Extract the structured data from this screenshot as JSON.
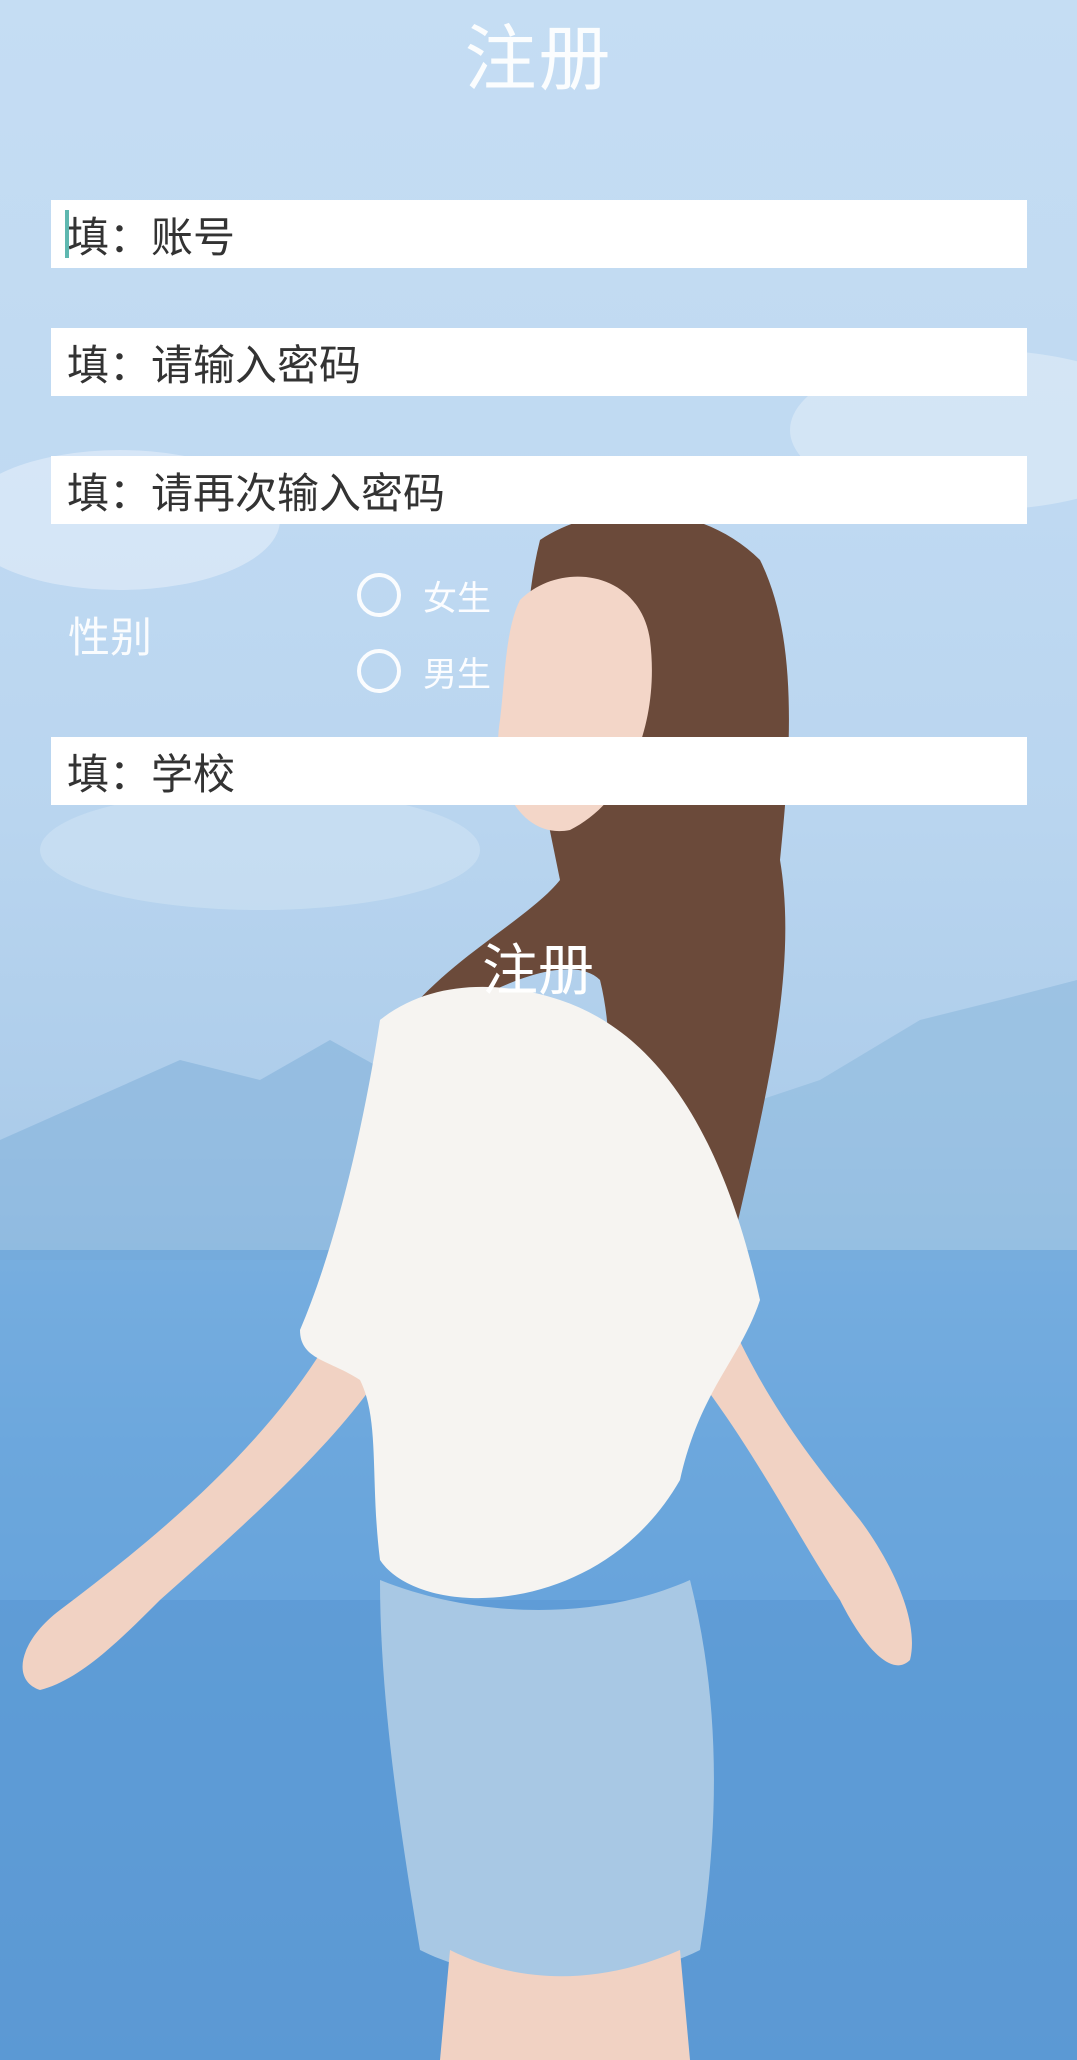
{
  "header": {
    "title": "注册"
  },
  "form": {
    "account_placeholder": "填：账号",
    "password_placeholder": "填：请输入密码",
    "confirm_password_placeholder": "填：请再次输入密码",
    "gender": {
      "label": "性别",
      "options": [
        "女生",
        "男生"
      ]
    },
    "school_placeholder": "填：学校",
    "submit_label": "注册"
  }
}
